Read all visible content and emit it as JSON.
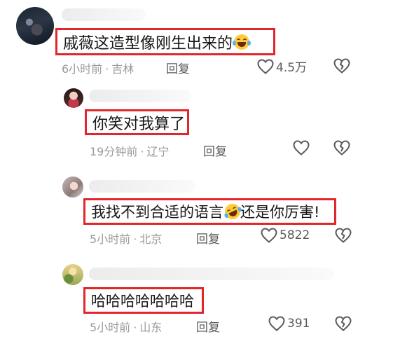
{
  "comments": [
    {
      "text": "戚薇这造型像刚生出来的",
      "emoji": "laughing-tears-icon",
      "time": "6小时前",
      "location": "吉林",
      "reply_label": "回复",
      "likes": "4.5万"
    },
    {
      "text": "你笑对我算了",
      "time": "19分钟前",
      "location": "辽宁",
      "reply_label": "回复",
      "likes": ""
    },
    {
      "text_before": "我找不到合适的语言",
      "emoji": "rolling-laughing-icon",
      "text_after": "还是你厉害!",
      "time": "5小时前",
      "location": "北京",
      "reply_label": "回复",
      "likes": "5822"
    },
    {
      "text": "哈哈哈哈哈哈哈",
      "time": "5小时前",
      "location": "山东",
      "reply_label": "回复",
      "likes": "391"
    }
  ],
  "meta_separator": "·",
  "colors": {
    "highlight_border": "#e3262c",
    "meta_text": "#9a9a9a",
    "action_text": "#5a5a5a"
  }
}
